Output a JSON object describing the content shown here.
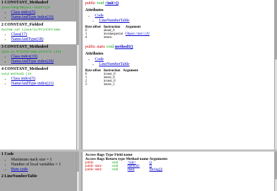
{
  "constant_pool": [
    {
      "title": "1 CONSTANT_Methodref",
      "style": "gray",
      "code": "java/lang/Object.<init>()V",
      "links": [
        "Class index(5)",
        "NameAndType index(16)"
      ]
    },
    {
      "title": "2 CONSTANT_Fieldref",
      "style": "white",
      "code": "System.out Ljava/io/PrintStream;",
      "links": [
        "Class(17)",
        "NameAndType(18)"
      ]
    },
    {
      "title": "3 CONSTANT_Methodref",
      "style": "gray",
      "code": "java.io.PrintStream.println (I)V",
      "links": [
        "Class index(19)",
        "NameAndType index(20)"
      ]
    },
    {
      "title": "4 CONSTANT_Methodref",
      "style": "white",
      "code": "void method1 ()V",
      "links": [
        "Class index(5)",
        "NameAndType index(21)"
      ]
    }
  ],
  "attributes_panel": {
    "code_title": "1 Code",
    "items": [
      "Maximum stack size = 1",
      "Number of local variables = 1"
    ],
    "link": "Byte code",
    "next_title": "2 LineNumberTable"
  },
  "methods": [
    {
      "header_public": "public",
      "header_void": "void",
      "header_name": "<init>()",
      "attributes_label": "Attributes",
      "attr_items": [
        {
          "link": "Code"
        },
        {
          "link": "LineNumberTable",
          "indent": true
        }
      ],
      "byte_header": [
        "Byte offset",
        "Instruction",
        "Argument"
      ],
      "rows": [
        [
          "0",
          "aload_0",
          ""
        ],
        [
          "1",
          "invokespecial",
          "Object.<init> ()V"
        ],
        [
          "4",
          "return",
          ""
        ]
      ]
    },
    {
      "header_public": "public static",
      "header_void": "void",
      "header_name": "method1()",
      "attributes_label": "Attributes",
      "attr_items": [
        {
          "link": "Code"
        },
        {
          "link": "LineNumberTable",
          "indent": true
        }
      ],
      "byte_header": [
        "Byte offset",
        "Instruction",
        "Argument"
      ],
      "rows": [
        [
          "0",
          "iconst_0",
          ""
        ],
        [
          "1",
          "istore_0",
          ""
        ],
        [
          "2",
          "iconst_0",
          ""
        ],
        [
          "3",
          "istore_1",
          ""
        ]
      ]
    }
  ],
  "fields_panel": {
    "line1": "Access flags Type Field name",
    "line2": "Access flags Return type Method name Arguments",
    "rows": [
      [
        "public",
        "void",
        "<init>",
        "()"
      ],
      [
        "public static",
        "void",
        "method1",
        "()"
      ],
      [
        "public static",
        "void",
        "main",
        "(String[])"
      ]
    ]
  },
  "colors": {
    "keyword_green": "#00a000",
    "method_red": "#cc0000",
    "link_blue": "#0000cc",
    "gray_item": "#a8a8a8"
  }
}
